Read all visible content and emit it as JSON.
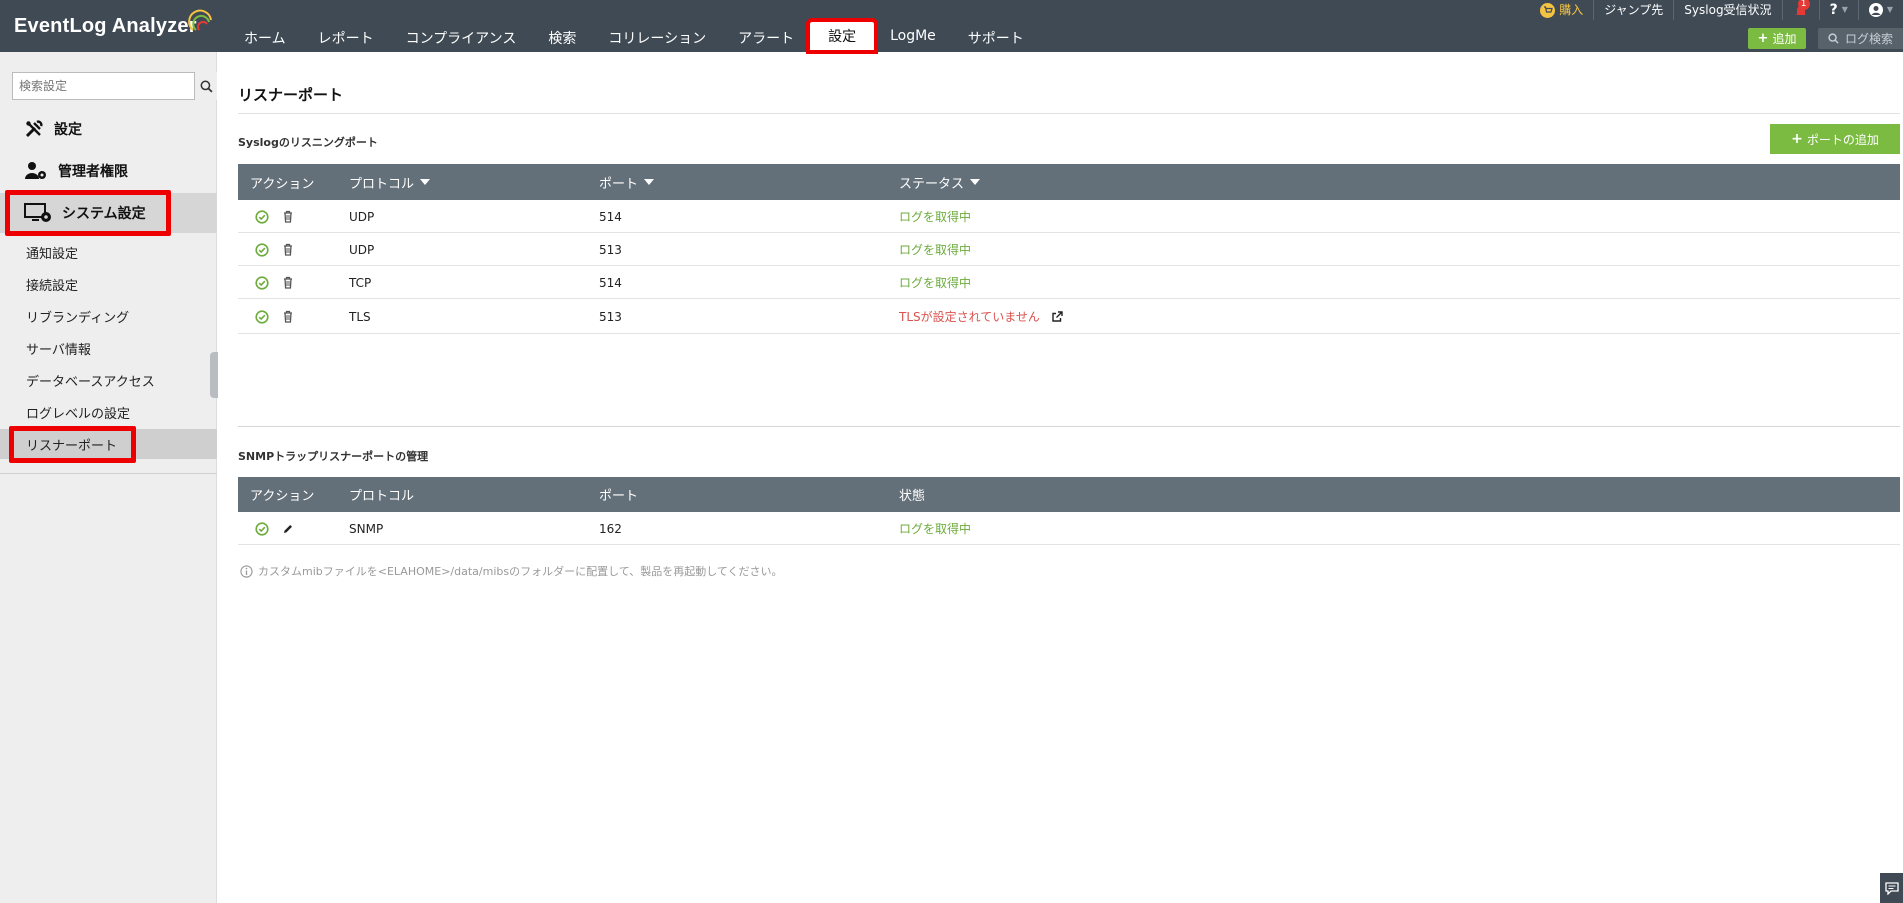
{
  "app": {
    "logo_text": "EventLog Analyzer"
  },
  "nav": [
    {
      "label": "ホーム",
      "active": false
    },
    {
      "label": "レポート",
      "active": false
    },
    {
      "label": "コンプライアンス",
      "active": false
    },
    {
      "label": "検索",
      "active": false
    },
    {
      "label": "コリレーション",
      "active": false
    },
    {
      "label": "アラート",
      "active": false
    },
    {
      "label": "設定",
      "active": true
    },
    {
      "label": "LogMe",
      "active": false
    },
    {
      "label": "サポート",
      "active": false
    }
  ],
  "top_links": {
    "buy": "購入",
    "jump": "ジャンプ先",
    "syslog_status": "Syslog受信状況",
    "notification_count": "1",
    "help": "?"
  },
  "header_actions": {
    "add_label": "追加",
    "log_search_placeholder": "ログ検索"
  },
  "sidebar": {
    "search_placeholder": "検索設定",
    "sections": [
      {
        "label": "設定",
        "icon": "tools-icon"
      },
      {
        "label": "管理者権限",
        "icon": "admin-user-icon"
      },
      {
        "label": "システム設定",
        "icon": "monitor-settings-icon",
        "selected": true
      }
    ],
    "items": [
      {
        "label": "通知設定"
      },
      {
        "label": "接続設定"
      },
      {
        "label": "リブランディング"
      },
      {
        "label": "サーバ情報"
      },
      {
        "label": "データベースアクセス"
      },
      {
        "label": "ログレベルの設定"
      },
      {
        "label": "リスナーポート",
        "selected": true
      }
    ]
  },
  "main": {
    "title": "リスナーポート",
    "syslog": {
      "label": "Syslogのリスニングポート",
      "add_button": "ポートの追加",
      "headers": {
        "action": "アクション",
        "protocol": "プロトコル",
        "port": "ポート",
        "status": "ステータス"
      },
      "rows": [
        {
          "protocol": "UDP",
          "port": "514",
          "status": "ログを取得中",
          "status_type": "ok"
        },
        {
          "protocol": "UDP",
          "port": "513",
          "status": "ログを取得中",
          "status_type": "ok"
        },
        {
          "protocol": "TCP",
          "port": "514",
          "status": "ログを取得中",
          "status_type": "ok"
        },
        {
          "protocol": "TLS",
          "port": "513",
          "status": "TLSが設定されていません",
          "status_type": "error"
        }
      ]
    },
    "snmp": {
      "label": "SNMPトラップリスナーポートの管理",
      "headers": {
        "action": "アクション",
        "protocol": "プロトコル",
        "port": "ポート",
        "status": "状態"
      },
      "rows": [
        {
          "protocol": "SNMP",
          "port": "162",
          "status": "ログを取得中",
          "status_type": "ok"
        }
      ]
    },
    "note": "カスタムmibファイルを<ELAHOME>/data/mibsのフォルダーに配置して、製品を再起動してください。"
  },
  "colors": {
    "topbar": "#3f4a54",
    "table_header": "#647079",
    "accent_green": "#7cbb42",
    "status_ok": "#6cab3c",
    "status_error": "#d9534f",
    "highlight": "#ee0000"
  }
}
